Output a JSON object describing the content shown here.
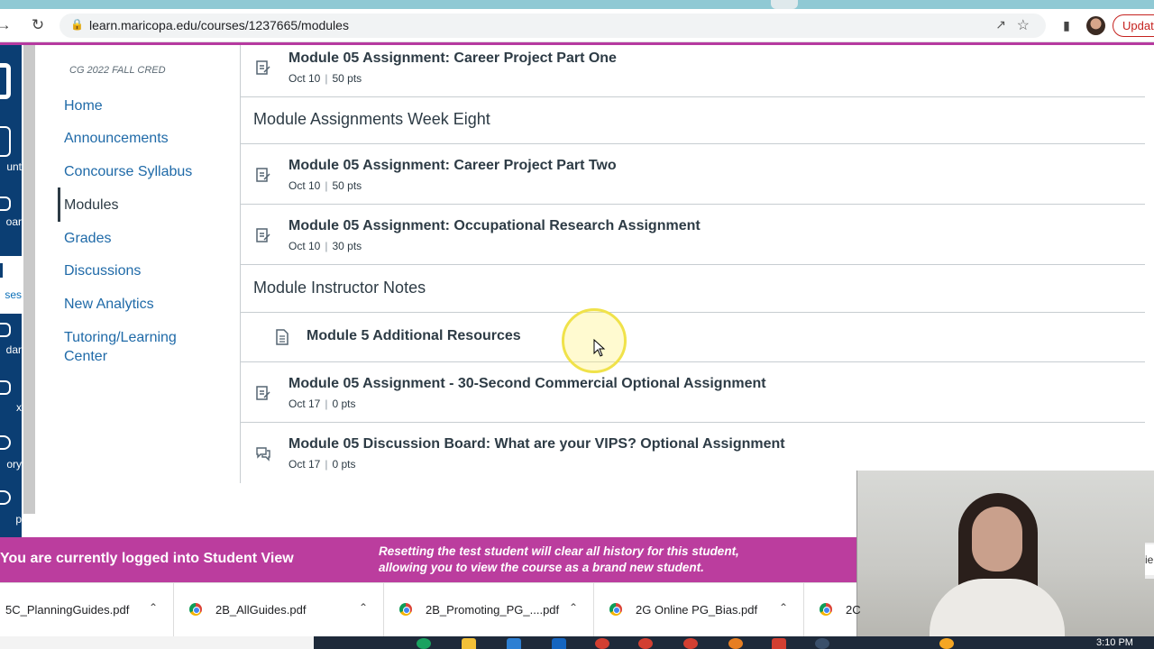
{
  "browser": {
    "url": "learn.maricopa.edu/courses/1237665/modules",
    "update_label": "Updat"
  },
  "global_nav": {
    "items": [
      "unt",
      "oar",
      "ses",
      "dar",
      "x",
      "ory",
      "p"
    ]
  },
  "course_nav": {
    "term": "CG 2022 FALL CRED",
    "items": [
      "Home",
      "Announcements",
      "Concourse Syllabus",
      "Modules",
      "Grades",
      "Discussions",
      "New Analytics",
      "Tutoring/Learning",
      "Center"
    ]
  },
  "modules": {
    "items": [
      {
        "title": "Module 05 Assignment: Career Project Part One",
        "date": "Oct 10",
        "pts": "50 pts"
      },
      {
        "header": "Module Assignments Week Eight"
      },
      {
        "title": "Module 05 Assignment: Career Project Part Two",
        "date": "Oct 10",
        "pts": "50 pts"
      },
      {
        "title": "Module 05 Assignment: Occupational Research Assignment",
        "date": "Oct 10",
        "pts": "30 pts"
      },
      {
        "header": "Module Instructor Notes"
      },
      {
        "title": "Module 5 Additional Resources"
      },
      {
        "title": "Module 05 Assignment - 30-Second Commercial Optional Assignment",
        "date": "Oct 17",
        "pts": "0 pts"
      },
      {
        "title": "Module 05 Discussion Board: What are your VIPS? Optional Assignment",
        "date": "Oct 17",
        "pts": "0 pts"
      }
    ],
    "separator": "|"
  },
  "banner": {
    "title": "You are currently logged into Student View",
    "description": "Resetting the test student will clear all history for this student, allowing you to view the course as a brand new student.",
    "right_fragment": "ie"
  },
  "downloads": [
    {
      "name": "5C_PlanningGuides.pdf"
    },
    {
      "name": "2B_AllGuides.pdf"
    },
    {
      "name": "2B_Promoting_PG_....pdf"
    },
    {
      "name": "2G Online PG_Bias.pdf"
    },
    {
      "name": "2C"
    }
  ],
  "taskbar": {
    "clock": "3:10 PM"
  },
  "colors": {
    "brand_nav": "#0b3e73",
    "link": "#1f6aa8",
    "student_view_banner": "#bb3d9e",
    "accent_line": "#b63aa0"
  },
  "icons": {
    "assignment": "assignment-icon",
    "page": "page-icon",
    "discussion": "discussion-icon"
  }
}
